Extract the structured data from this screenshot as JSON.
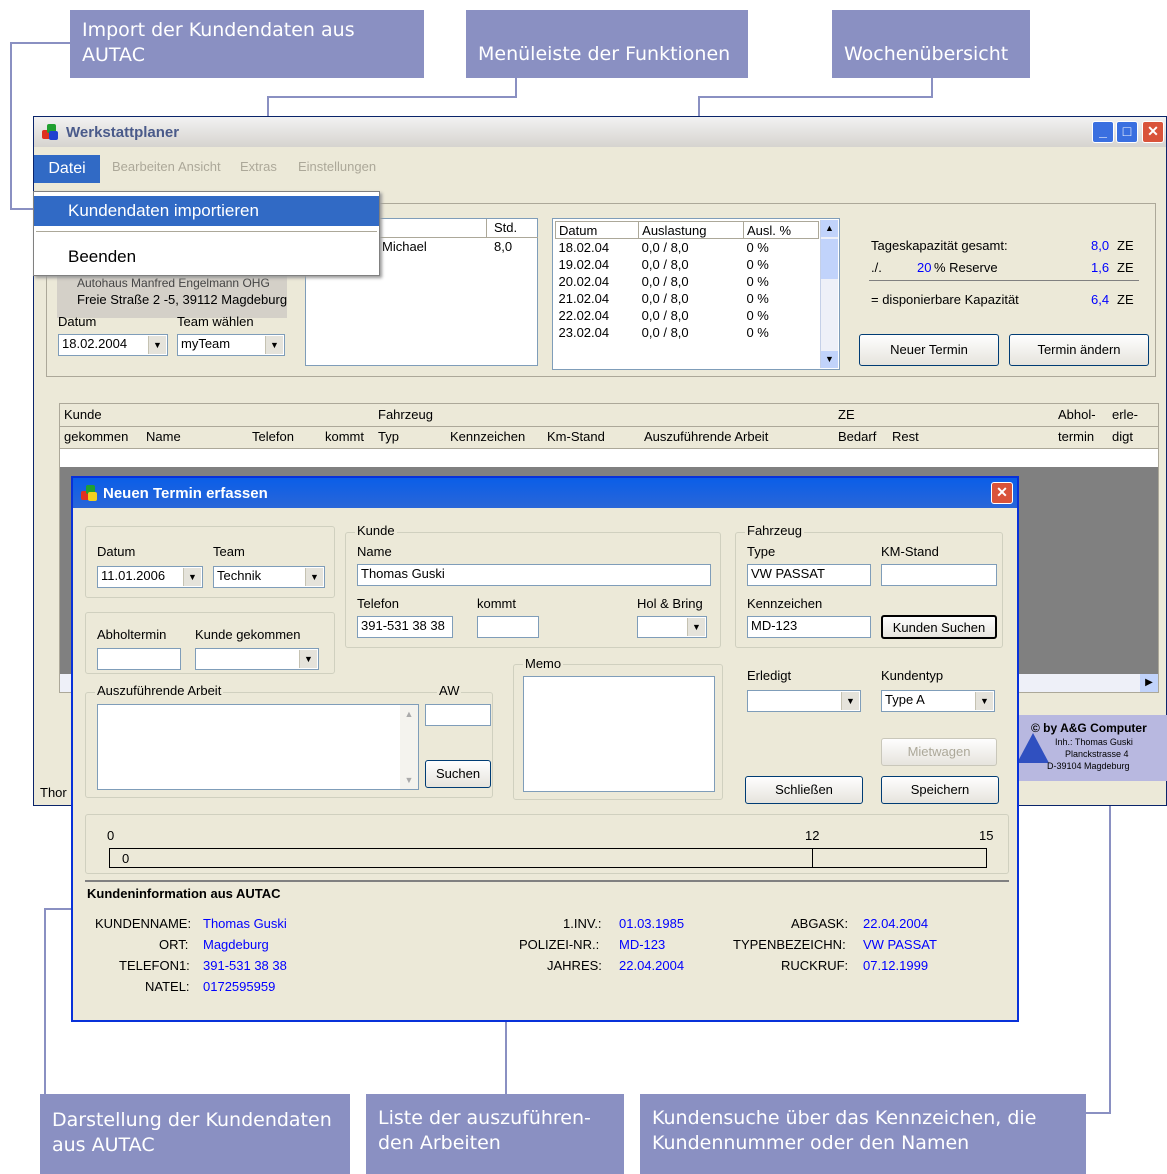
{
  "callouts": {
    "import": "Import der Kundendaten aus AUTAC",
    "menu": "Menüleiste der Funktionen",
    "week": "Wochenübersicht",
    "customer_display": "Darstellung der Kundendaten aus AUTAC",
    "work_list": "Liste der auszuführen-den Arbeiten",
    "search": "Kundensuche über das Kennzeichen, die Kundennummer oder den Namen"
  },
  "window": {
    "title": "Werkstattplaner",
    "menu": [
      "Datei",
      "Bearbeiten",
      "Ansicht",
      "Extras",
      "Einstellungen"
    ],
    "dropdown": [
      "Kundendaten importieren",
      "Beenden"
    ]
  },
  "top": {
    "address_line1": "Autohaus Manfred Engelmann OHG",
    "address_line2": "Freie Straße 2 -5, 39112 Magdeburg",
    "datum_label": "Datum",
    "team_label": "Team wählen",
    "datum_value": "18.02.2004",
    "team_value": "myTeam",
    "staff_header_std": "Std.",
    "staff_name": "Michael",
    "staff_std": "8,0",
    "week_headers": [
      "Datum",
      "Auslastung",
      "Ausl. %"
    ],
    "week_rows": [
      [
        "18.02.04",
        "0,0 / 8,0",
        "0 %"
      ],
      [
        "19.02.04",
        "0,0 / 8,0",
        "0 %"
      ],
      [
        "20.02.04",
        "0,0 / 8,0",
        "0 %"
      ],
      [
        "21.02.04",
        "0,0 / 8,0",
        "0 %"
      ],
      [
        "22.02.04",
        "0,0 / 8,0",
        "0 %"
      ],
      [
        "23.02.04",
        "0,0 / 8,0",
        "0 %"
      ]
    ],
    "cap_total_label": "Tageskapazität gesamt:",
    "cap_total_value": "8,0",
    "cap_reserve_prefix": "./.",
    "cap_reserve_pct": "20",
    "cap_reserve_label": "% Reserve",
    "cap_reserve_value": "1,6",
    "cap_avail_label": "= disponierbare Kapazität",
    "cap_avail_value": "6,4",
    "unit": "ZE",
    "btn_new": "Neuer Termin",
    "btn_change": "Termin ändern"
  },
  "grid": {
    "group_headers": [
      "Kunde",
      "Fahrzeug",
      "ZE",
      "Abhol-",
      "erle-"
    ],
    "columns": [
      "gekommen",
      "Name",
      "Telefon",
      "kommt",
      "Typ",
      "Kennzeichen",
      "Km-Stand",
      "Auszuführende Arbeit",
      "Bedarf",
      "Rest",
      "termin",
      "digt"
    ]
  },
  "footer": {
    "copyright": "© by A&G Computer",
    "owner": "Inh.: Thomas Guski",
    "street": "Planckstrasse 4",
    "city": "D-39104 Magdeburg",
    "status_left": "Thor"
  },
  "dialog": {
    "title": "Neuen Termin erfassen",
    "datum_label": "Datum",
    "team_label": "Team",
    "datum_value": "11.01.2006",
    "team_value": "Technik",
    "abhol_label": "Abholtermin",
    "kunde_gekommen_label": "Kunde gekommen",
    "kunde_group": "Kunde",
    "name_label": "Name",
    "name_value": "Thomas Guski",
    "telefon_label": "Telefon",
    "telefon_value": "391-531 38 38",
    "kommt_label": "kommt",
    "holbring_label": "Hol & Bring",
    "fahrzeug_group": "Fahrzeug",
    "type_label": "Type",
    "type_value": "VW PASSAT",
    "kmstand_label": "KM-Stand",
    "kennzeichen_label": "Kennzeichen",
    "kennzeichen_value": "MD-123",
    "kunden_suchen": "Kunden Suchen",
    "arbeit_label": "Auszuführende Arbeit",
    "aw_label": "AW",
    "suchen": "Suchen",
    "memo_label": "Memo",
    "erledigt_label": "Erledigt",
    "kundentyp_label": "Kundentyp",
    "kundentyp_value": "Type A",
    "mietwagen": "Mietwagen",
    "schliessen": "Schließen",
    "speichern": "Speichern",
    "scale_min": "0",
    "scale_mid": "12",
    "scale_max": "15",
    "progress_value": "0",
    "info_title": "Kundeninformation aus AUTAC",
    "info_left": [
      [
        "KUNDENNAME:",
        "Thomas Guski"
      ],
      [
        "ORT:",
        "Magdeburg"
      ],
      [
        "TELEFON1:",
        "391-531 38 38"
      ],
      [
        "NATEL:",
        "0172595959"
      ]
    ],
    "info_mid": [
      [
        "1.INV.:",
        "01.03.1985"
      ],
      [
        "POLIZEI-NR.:",
        "MD-123"
      ],
      [
        "JAHRES:",
        "22.04.2004"
      ]
    ],
    "info_right": [
      [
        "ABGASK:",
        "22.04.2004"
      ],
      [
        "TYPENBEZEICHN:",
        "VW PASSAT"
      ],
      [
        "RUCKRUF:",
        "07.12.1999"
      ]
    ]
  }
}
